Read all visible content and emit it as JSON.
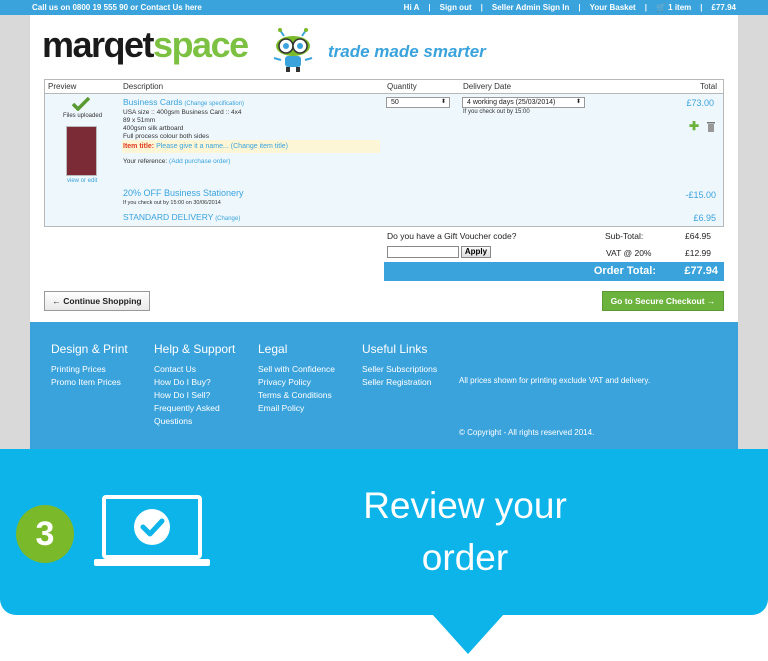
{
  "topbar": {
    "call": "Call us on 0800 19 555 90 or Contact Us here",
    "links": [
      "Hi A",
      "Sign out",
      "Seller Admin Sign In",
      "Your Basket"
    ],
    "basket_items": "1 item",
    "basket_total": "£77.94"
  },
  "brand": {
    "logo_a": "marqet",
    "logo_b": "space",
    "tagline": "trade made smarter"
  },
  "table": {
    "headers": [
      "Preview",
      "Description",
      "Quantity",
      "Delivery Date",
      "Total"
    ],
    "files_uploaded": "Files uploaded",
    "view_or_edit": "view or edit",
    "product": {
      "name": "Business Cards",
      "change_spec": "(Change specification)",
      "lines": [
        "USA size :: 400gsm Business Card :: 4x4",
        "89 x 51mm",
        "400gsm silk artboard",
        "Full process colour both sides"
      ],
      "item_title_label": "Item title:",
      "item_title_value": "Please give it a name... (Change item title)",
      "reference_label": "Your reference:",
      "reference_link": "(Add purchase order)",
      "quantity": "50",
      "delivery": "4 working days (25/03/2014)",
      "delivery_note": "If you check out by 15:00",
      "total": "£73.00"
    },
    "discount": {
      "name": "20% OFF Business Stationery",
      "note": "If you check out by 15:00 on 30/06/2014",
      "total": "-£15.00"
    },
    "shipping": {
      "name": "STANDARD DELIVERY",
      "change": "(Change)",
      "total": "£6.95"
    }
  },
  "totals": {
    "voucher_q": "Do you have a Gift Voucher code?",
    "apply": "Apply",
    "subtotal_label": "Sub-Total:",
    "subtotal": "£64.95",
    "vat_label": "VAT @ 20%",
    "vat": "£12.99",
    "order_total_label": "Order Total:",
    "order_total": "£77.94"
  },
  "buttons": {
    "continue": "← Continue Shopping",
    "checkout": "Go to Secure Checkout →"
  },
  "footer": {
    "cols": [
      {
        "title": "Design & Print",
        "items": [
          "Printing Prices",
          "Promo Item Prices"
        ]
      },
      {
        "title": "Help & Support",
        "items": [
          "Contact Us",
          "How Do I Buy?",
          "How Do I Sell?",
          "Frequently Asked",
          "Questions"
        ]
      },
      {
        "title": "Legal",
        "items": [
          "Sell with Confidence",
          "Privacy Policy",
          "Terms & Conditions",
          "Email Policy"
        ]
      },
      {
        "title": "Useful Links",
        "items": [
          "Seller Subscriptions",
          "Seller Registration"
        ]
      }
    ],
    "note": "All prices shown for printing exclude VAT and delivery.",
    "copyright": "© Copyright - All rights reserved 2014."
  },
  "banner": {
    "step": "3",
    "line1": "Review your",
    "line2": "order"
  },
  "colors": {
    "brand_blue": "#3aa3dc",
    "green": "#7ab929",
    "banner": "#0cb4ea"
  }
}
